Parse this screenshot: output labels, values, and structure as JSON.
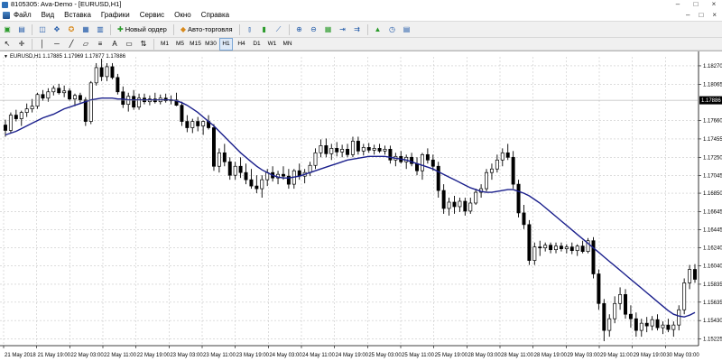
{
  "window": {
    "title": "8105305: Ava-Demo - [EURUSD,H1]",
    "controls": [
      "–",
      "□",
      "×"
    ]
  },
  "menu": {
    "items": [
      "Файл",
      "Вид",
      "Вставка",
      "Графики",
      "Сервис",
      "Окно",
      "Справка"
    ],
    "right_controls": [
      "–",
      "□",
      "×"
    ]
  },
  "toolbar": {
    "new_order_label": "Новый ордер",
    "autotrading_label": "Авто-торговля"
  },
  "timeframes": {
    "items": [
      "M1",
      "M5",
      "M15",
      "M30",
      "H1",
      "H4",
      "D1",
      "W1",
      "MN"
    ],
    "active": "H1"
  },
  "chart": {
    "header": "EURUSD,H1  1.17885 1.17969 1.17877 1.17886",
    "current_price_label": "1.17886"
  },
  "colors": {
    "candle": "#000000",
    "ma_line": "#1a1f8c",
    "grid": "#c8c8c8",
    "price_tag_bg": "#000000",
    "price_tag_text": "#ffffff"
  },
  "chart_data": {
    "type": "candlestick",
    "symbol": "EURUSD",
    "timeframe": "H1",
    "ylim": [
      1.1515,
      1.1837
    ],
    "y_ticks": [
      "1.18270",
      "1.18065",
      "1.17660",
      "1.17455",
      "1.17250",
      "1.17045",
      "1.16850",
      "1.16645",
      "1.16445",
      "1.16240",
      "1.16040",
      "1.15835",
      "1.15635",
      "1.15430",
      "1.15225"
    ],
    "y_tick_values": [
      1.1827,
      1.18065,
      1.1766,
      1.17455,
      1.1725,
      1.17045,
      1.1685,
      1.16645,
      1.16445,
      1.1624,
      1.1604,
      1.15835,
      1.15635,
      1.1543,
      1.15225
    ],
    "x_ticks": [
      "21 May 2018",
      "21 May 19:00",
      "22 May 03:00",
      "22 May 11:00",
      "22 May 19:00",
      "23 May 03:00",
      "23 May 11:00",
      "23 May 19:00",
      "24 May 03:00",
      "24 May 11:00",
      "24 May 19:00",
      "25 May 03:00",
      "25 May 11:00",
      "25 May 19:00",
      "28 May 03:00",
      "28 May 11:00",
      "28 May 19:00",
      "29 May 03:00",
      "29 May 11:00",
      "29 May 19:00",
      "30 May 03:00"
    ],
    "current_price": 1.17886,
    "candles": [
      [
        1.1761,
        1.1767,
        1.1748,
        1.1755
      ],
      [
        1.1755,
        1.1775,
        1.1752,
        1.1772
      ],
      [
        1.1772,
        1.1778,
        1.1765,
        1.1768
      ],
      [
        1.1768,
        1.1777,
        1.176,
        1.1775
      ],
      [
        1.1775,
        1.1785,
        1.177,
        1.1779
      ],
      [
        1.1779,
        1.179,
        1.1775,
        1.1782
      ],
      [
        1.1782,
        1.1797,
        1.1779,
        1.1795
      ],
      [
        1.1795,
        1.18,
        1.1788,
        1.1791
      ],
      [
        1.1791,
        1.1802,
        1.1787,
        1.1798
      ],
      [
        1.1798,
        1.1805,
        1.1794,
        1.1802
      ],
      [
        1.1802,
        1.1807,
        1.1795,
        1.1797
      ],
      [
        1.1797,
        1.1805,
        1.1792,
        1.1799
      ],
      [
        1.1799,
        1.1802,
        1.1788,
        1.179
      ],
      [
        1.179,
        1.1796,
        1.1782,
        1.1794
      ],
      [
        1.1794,
        1.1797,
        1.1786,
        1.1789
      ],
      [
        1.1789,
        1.1792,
        1.176,
        1.1765
      ],
      [
        1.1765,
        1.181,
        1.1762,
        1.1808
      ],
      [
        1.1808,
        1.183,
        1.1805,
        1.1825
      ],
      [
        1.1825,
        1.1835,
        1.181,
        1.1815
      ],
      [
        1.1815,
        1.183,
        1.181,
        1.1826
      ],
      [
        1.1826,
        1.183,
        1.1812,
        1.1814
      ],
      [
        1.1814,
        1.1818,
        1.1795,
        1.1798
      ],
      [
        1.1798,
        1.1804,
        1.178,
        1.1784
      ],
      [
        1.1784,
        1.1797,
        1.1776,
        1.1793
      ],
      [
        1.1793,
        1.18,
        1.1778,
        1.1781
      ],
      [
        1.1781,
        1.1796,
        1.1778,
        1.1791
      ],
      [
        1.1791,
        1.1796,
        1.1784,
        1.1787
      ],
      [
        1.1787,
        1.1794,
        1.1783,
        1.179
      ],
      [
        1.179,
        1.1797,
        1.1785,
        1.1787
      ],
      [
        1.1787,
        1.1795,
        1.1784,
        1.1791
      ],
      [
        1.1791,
        1.1796,
        1.1786,
        1.1788
      ],
      [
        1.1788,
        1.1794,
        1.1784,
        1.1789
      ],
      [
        1.1789,
        1.1797,
        1.1782,
        1.1783
      ],
      [
        1.1783,
        1.1787,
        1.176,
        1.1765
      ],
      [
        1.1765,
        1.1772,
        1.1753,
        1.1758
      ],
      [
        1.1758,
        1.1768,
        1.1752,
        1.1765
      ],
      [
        1.1765,
        1.177,
        1.1754,
        1.176
      ],
      [
        1.176,
        1.1766,
        1.175,
        1.1765
      ],
      [
        1.1765,
        1.1772,
        1.1756,
        1.1758
      ],
      [
        1.1758,
        1.1762,
        1.171,
        1.1715
      ],
      [
        1.1715,
        1.1735,
        1.1708,
        1.173
      ],
      [
        1.173,
        1.174,
        1.1715,
        1.172
      ],
      [
        1.172,
        1.1725,
        1.17,
        1.1705
      ],
      [
        1.1705,
        1.172,
        1.17,
        1.1715
      ],
      [
        1.1715,
        1.1725,
        1.1702,
        1.1708
      ],
      [
        1.1708,
        1.1718,
        1.1695,
        1.17
      ],
      [
        1.17,
        1.1712,
        1.169,
        1.1693
      ],
      [
        1.1693,
        1.1705,
        1.1685,
        1.169
      ],
      [
        1.169,
        1.1705,
        1.168,
        1.17
      ],
      [
        1.17,
        1.1712,
        1.1693,
        1.1708
      ],
      [
        1.1708,
        1.1715,
        1.1698,
        1.1702
      ],
      [
        1.1702,
        1.171,
        1.1695,
        1.1706
      ],
      [
        1.1706,
        1.1715,
        1.17,
        1.1704
      ],
      [
        1.1704,
        1.1712,
        1.169,
        1.1695
      ],
      [
        1.1695,
        1.1712,
        1.169,
        1.171
      ],
      [
        1.171,
        1.1718,
        1.17,
        1.1704
      ],
      [
        1.1704,
        1.1712,
        1.1696,
        1.1708
      ],
      [
        1.1708,
        1.172,
        1.1704,
        1.1716
      ],
      [
        1.1716,
        1.1735,
        1.1712,
        1.173
      ],
      [
        1.173,
        1.1745,
        1.1725,
        1.1738
      ],
      [
        1.1738,
        1.1746,
        1.1725,
        1.1729
      ],
      [
        1.1729,
        1.174,
        1.1722,
        1.1735
      ],
      [
        1.1735,
        1.1742,
        1.1726,
        1.1731
      ],
      [
        1.1731,
        1.1739,
        1.1725,
        1.1734
      ],
      [
        1.1734,
        1.174,
        1.1725,
        1.1728
      ],
      [
        1.1728,
        1.1748,
        1.1725,
        1.1743
      ],
      [
        1.1743,
        1.1748,
        1.1728,
        1.1732
      ],
      [
        1.1732,
        1.174,
        1.1727,
        1.1736
      ],
      [
        1.1736,
        1.1741,
        1.173,
        1.1733
      ],
      [
        1.1733,
        1.1739,
        1.1728,
        1.1735
      ],
      [
        1.1735,
        1.174,
        1.173,
        1.1732
      ],
      [
        1.1732,
        1.1738,
        1.1728,
        1.1734
      ],
      [
        1.1734,
        1.1738,
        1.1718,
        1.1722
      ],
      [
        1.1722,
        1.173,
        1.1715,
        1.1726
      ],
      [
        1.1726,
        1.1732,
        1.1718,
        1.172
      ],
      [
        1.172,
        1.1728,
        1.1712,
        1.1725
      ],
      [
        1.1725,
        1.173,
        1.1715,
        1.1718
      ],
      [
        1.1718,
        1.1725,
        1.1705,
        1.171
      ],
      [
        1.171,
        1.173,
        1.17,
        1.1728
      ],
      [
        1.1728,
        1.1735,
        1.1718,
        1.1722
      ],
      [
        1.1722,
        1.1728,
        1.171,
        1.1715
      ],
      [
        1.1715,
        1.172,
        1.168,
        1.1688
      ],
      [
        1.1688,
        1.1695,
        1.1662,
        1.1668
      ],
      [
        1.1668,
        1.168,
        1.166,
        1.1675
      ],
      [
        1.1675,
        1.1682,
        1.1662,
        1.167
      ],
      [
        1.167,
        1.168,
        1.1664,
        1.1676
      ],
      [
        1.1676,
        1.168,
        1.166,
        1.1665
      ],
      [
        1.1665,
        1.168,
        1.1662,
        1.1674
      ],
      [
        1.1674,
        1.169,
        1.1672,
        1.1686
      ],
      [
        1.1686,
        1.1695,
        1.168,
        1.169
      ],
      [
        1.169,
        1.1712,
        1.1687,
        1.1708
      ],
      [
        1.1708,
        1.1718,
        1.17,
        1.1712
      ],
      [
        1.1712,
        1.1728,
        1.1708,
        1.1722
      ],
      [
        1.1722,
        1.1735,
        1.1715,
        1.173
      ],
      [
        1.173,
        1.174,
        1.1722,
        1.1725
      ],
      [
        1.1725,
        1.1732,
        1.169,
        1.1695
      ],
      [
        1.1695,
        1.17,
        1.1658,
        1.1663
      ],
      [
        1.1663,
        1.1672,
        1.1645,
        1.165
      ],
      [
        1.165,
        1.1655,
        1.1605,
        1.161
      ],
      [
        1.161,
        1.163,
        1.1605,
        1.1625
      ],
      [
        1.1625,
        1.1632,
        1.1615,
        1.1624
      ],
      [
        1.1624,
        1.163,
        1.162,
        1.1627
      ],
      [
        1.1627,
        1.163,
        1.1618,
        1.1622
      ],
      [
        1.1622,
        1.163,
        1.1618,
        1.1626
      ],
      [
        1.1626,
        1.163,
        1.162,
        1.1623
      ],
      [
        1.1623,
        1.1628,
        1.1618,
        1.1625
      ],
      [
        1.1625,
        1.163,
        1.1617,
        1.1621
      ],
      [
        1.1621,
        1.1628,
        1.1615,
        1.1626
      ],
      [
        1.1626,
        1.1632,
        1.1618,
        1.162
      ],
      [
        1.162,
        1.1635,
        1.1618,
        1.1632
      ],
      [
        1.1632,
        1.1636,
        1.159,
        1.1595
      ],
      [
        1.1595,
        1.16,
        1.1555,
        1.1562
      ],
      [
        1.1562,
        1.1567,
        1.152,
        1.1532
      ],
      [
        1.1532,
        1.155,
        1.1525,
        1.1545
      ],
      [
        1.1545,
        1.157,
        1.154,
        1.1562
      ],
      [
        1.1562,
        1.158,
        1.1555,
        1.1572
      ],
      [
        1.1572,
        1.1578,
        1.1545,
        1.155
      ],
      [
        1.155,
        1.156,
        1.1535,
        1.1545
      ],
      [
        1.1545,
        1.1552,
        1.1525,
        1.1532
      ],
      [
        1.1532,
        1.1545,
        1.1525,
        1.154
      ],
      [
        1.154,
        1.1547,
        1.153,
        1.1537
      ],
      [
        1.1537,
        1.1548,
        1.1532,
        1.1544
      ],
      [
        1.1544,
        1.155,
        1.1532,
        1.1535
      ],
      [
        1.1535,
        1.1542,
        1.1528,
        1.1538
      ],
      [
        1.1538,
        1.1545,
        1.153,
        1.1533
      ],
      [
        1.1533,
        1.1542,
        1.1525,
        1.1538
      ],
      [
        1.1538,
        1.156,
        1.1532,
        1.1555
      ],
      [
        1.1555,
        1.159,
        1.155,
        1.1585
      ],
      [
        1.1585,
        1.1605,
        1.1578,
        1.16
      ],
      [
        1.16,
        1.1606,
        1.1585,
        1.1589
      ]
    ],
    "moving_average": [
      1.175,
      1.1752,
      1.1754,
      1.1757,
      1.176,
      1.1763,
      1.1766,
      1.1769,
      1.1771,
      1.1773,
      1.1776,
      1.1779,
      1.1781,
      1.1783,
      1.1785,
      1.1787,
      1.1789,
      1.179,
      1.1791,
      1.1791,
      1.1791,
      1.179,
      1.179,
      1.1789,
      1.1789,
      1.1789,
      1.1789,
      1.1789,
      1.1789,
      1.1789,
      1.1789,
      1.1789,
      1.1788,
      1.1786,
      1.1783,
      1.1779,
      1.1775,
      1.177,
      1.1765,
      1.176,
      1.1754,
      1.1748,
      1.1742,
      1.1736,
      1.173,
      1.1725,
      1.172,
      1.1715,
      1.1711,
      1.1708,
      1.1705,
      1.1703,
      1.1702,
      1.1702,
      1.1703,
      1.1704,
      1.1706,
      1.1708,
      1.171,
      1.1712,
      1.1714,
      1.1716,
      1.1718,
      1.172,
      1.1722,
      1.1723,
      1.1724,
      1.1725,
      1.1726,
      1.1726,
      1.1726,
      1.1726,
      1.1725,
      1.1724,
      1.1723,
      1.1722,
      1.172,
      1.1718,
      1.1716,
      1.1714,
      1.1712,
      1.1709,
      1.1706,
      1.1703,
      1.17,
      1.1697,
      1.1694,
      1.1691,
      1.1689,
      1.1687,
      1.1686,
      1.1686,
      1.1687,
      1.1688,
      1.1689,
      1.1689,
      1.1687,
      1.1685,
      1.1682,
      1.1678,
      1.1674,
      1.1669,
      1.1664,
      1.1659,
      1.1654,
      1.1649,
      1.1644,
      1.1639,
      1.1634,
      1.1629,
      1.1624,
      1.1619,
      1.1614,
      1.1609,
      1.1604,
      1.1599,
      1.1594,
      1.1589,
      1.1584,
      1.1579,
      1.1574,
      1.1569,
      1.1564,
      1.1559,
      1.1554,
      1.155,
      1.1548,
      1.1547,
      1.1549,
      1.1552
    ]
  }
}
